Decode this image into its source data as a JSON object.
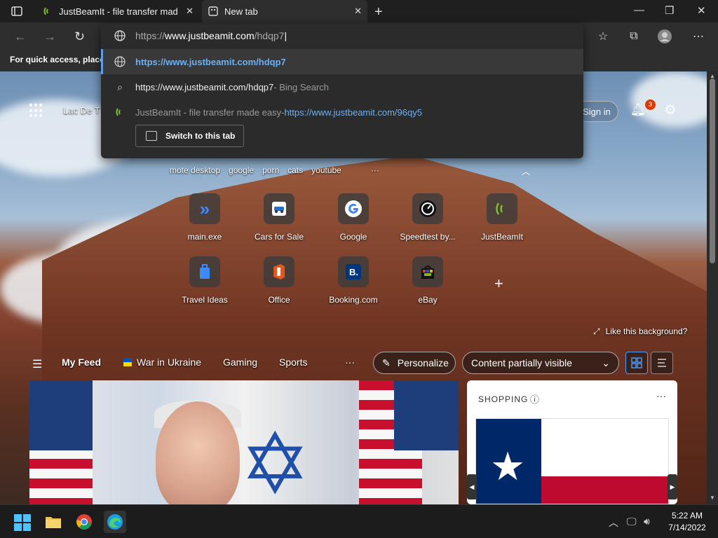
{
  "tabs": [
    {
      "label": "JustBeamIt - file transfer made easy",
      "icon": "justbeamit-icon",
      "active": false
    },
    {
      "label": "New tab",
      "icon": "newtab-icon",
      "active": true
    }
  ],
  "omnibox": {
    "value_proto": "https://",
    "value_domain": "www.justbeamit.com",
    "value_path": "/hdqp7",
    "suggestions": [
      {
        "text": "https://www.justbeamit.com/hdqp7",
        "icon": "globe-icon"
      },
      {
        "text": "https://www.justbeamit.com/hdqp7",
        "suffix": " - Bing Search",
        "icon": "search-icon"
      },
      {
        "text": "JustBeamIt - file transfer made easy",
        "suffix": " - ",
        "link": "https://www.justbeamit.com/96qy5",
        "icon": "justbeamit-icon"
      }
    ],
    "switch_label": "Switch to this tab"
  },
  "favbar_text": "For quick access, place y",
  "header": {
    "location": "Lac De T",
    "signin": "Sign in",
    "notif_count": "3"
  },
  "trending": [
    "mote desktop",
    "google",
    "porn",
    "cats",
    "youtube",
    "···"
  ],
  "quicklinks": [
    {
      "label": "main.exe",
      "icon": "chevron-icon",
      "glyph": "»",
      "color": "#3c8bff"
    },
    {
      "label": "Cars for Sale",
      "icon": "car-icon",
      "glyph": "🚗",
      "color": "#ffffff"
    },
    {
      "label": "Google",
      "icon": "google-icon",
      "glyph": "G",
      "color": "#4285f4"
    },
    {
      "label": "Speedtest by...",
      "icon": "speedometer-icon",
      "glyph": "◔",
      "color": "#ffffff"
    },
    {
      "label": "JustBeamIt",
      "icon": "justbeamit-icon",
      "glyph": "((",
      "color": "#7fbf2a"
    },
    {
      "label": "Travel Ideas",
      "icon": "luggage-icon",
      "glyph": "▮",
      "color": "#3c8bff"
    },
    {
      "label": "Office",
      "icon": "office-icon",
      "glyph": "O",
      "color": "#e2571e"
    },
    {
      "label": "Booking.com",
      "icon": "booking-icon",
      "glyph": "B.",
      "color": "#003580"
    },
    {
      "label": "eBay",
      "icon": "ebay-icon",
      "glyph": "■",
      "color": "#f5af02"
    }
  ],
  "like_bg": "Like this background?",
  "feed": {
    "myfeed": "My Feed",
    "items": [
      "War in Ukraine",
      "Gaming",
      "Sports"
    ],
    "more": "···",
    "personalize": "Personalize",
    "content_visibility": "Content partially visible"
  },
  "shopping": {
    "title": "SHOPPING",
    "more": "···"
  },
  "taskbar": {
    "time": "5:22 AM",
    "date": "7/14/2022"
  }
}
